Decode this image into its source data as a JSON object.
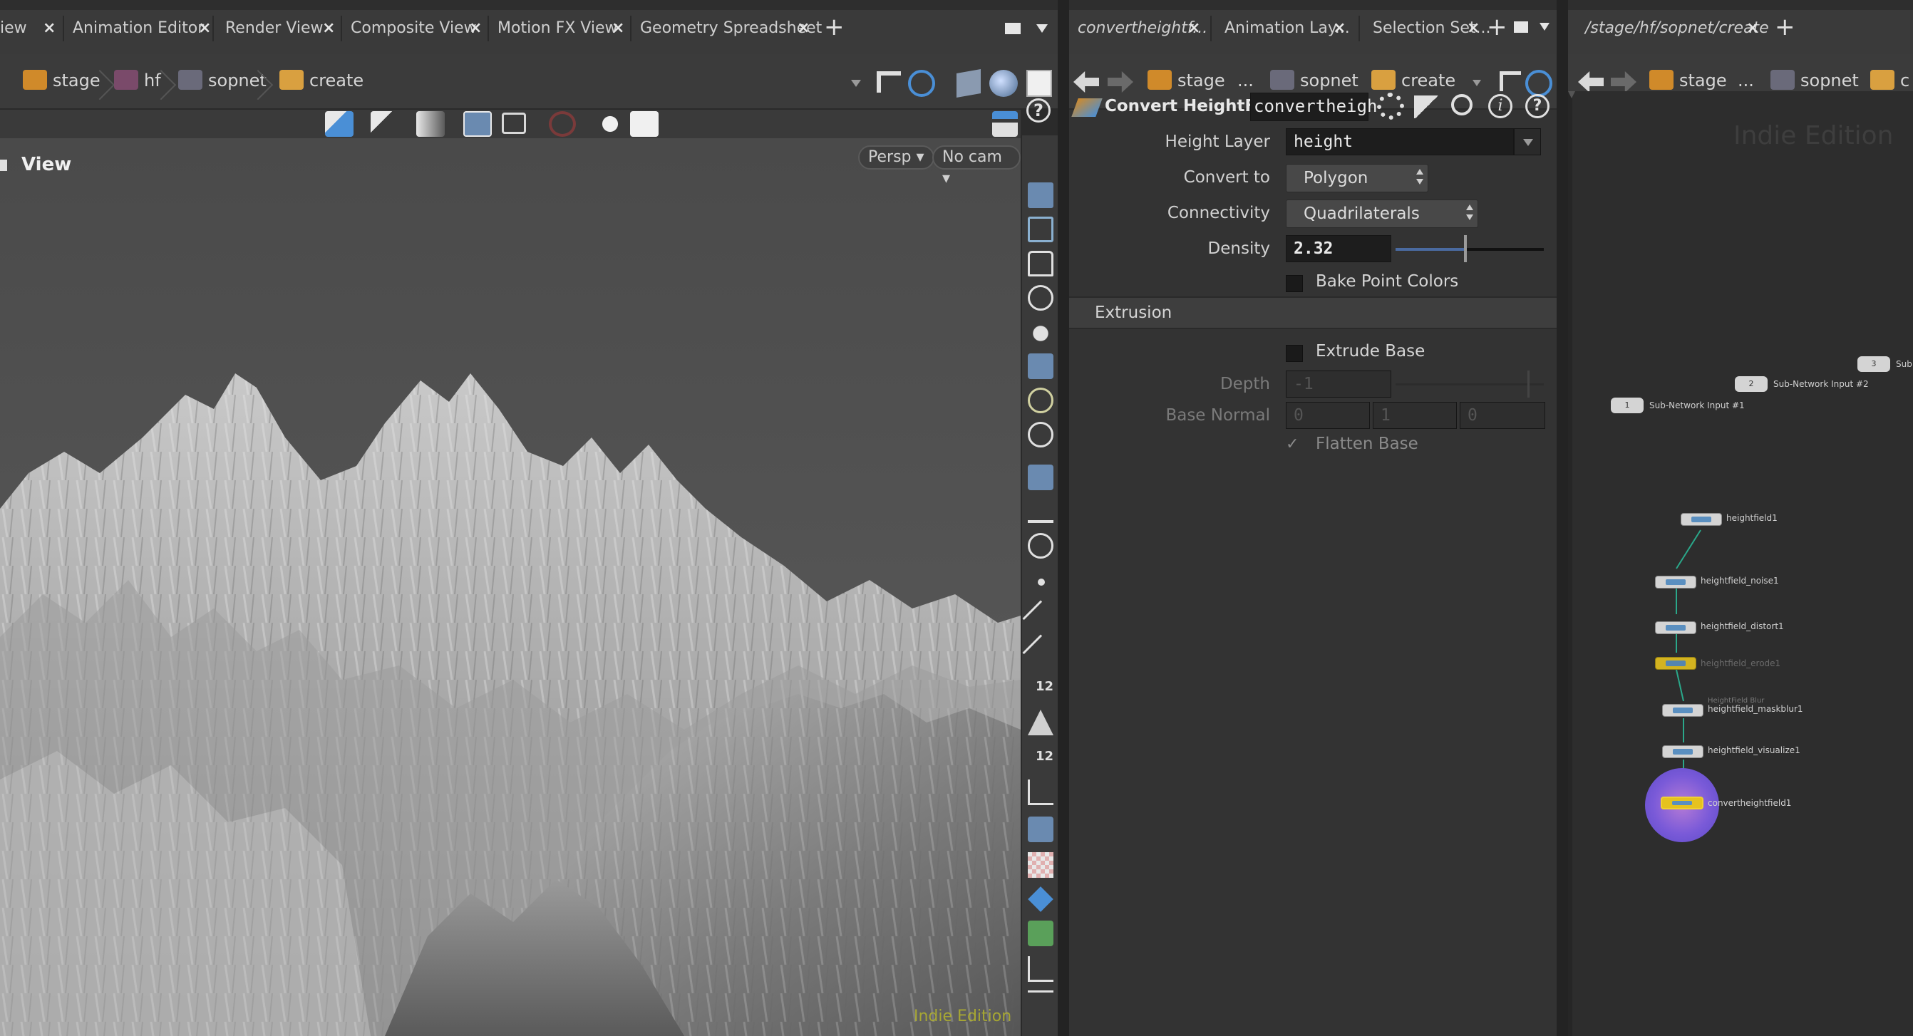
{
  "left_pane": {
    "tabs": [
      {
        "label": "iew"
      },
      {
        "label": "Animation Editor"
      },
      {
        "label": "Render View"
      },
      {
        "label": "Composite View"
      },
      {
        "label": "Motion FX View"
      },
      {
        "label": "Geometry Spreadsheet"
      }
    ],
    "path": [
      {
        "label": "stage",
        "icon": "stage-icon"
      },
      {
        "label": "hf",
        "icon": "hf-icon"
      },
      {
        "label": "sopnet",
        "icon": "sopnet-icon"
      },
      {
        "label": "create",
        "icon": "folder-icon"
      }
    ],
    "viewport": {
      "title": "View",
      "persp_label": "Persp",
      "camera_label": "No cam",
      "watermark": "Indie Edition"
    }
  },
  "params_pane": {
    "tabs": [
      {
        "label": "convertheightf..."
      },
      {
        "label": "Animation Lay..."
      },
      {
        "label": "Selection Set..."
      }
    ],
    "path": [
      {
        "label": "stage"
      },
      {
        "label": "..."
      },
      {
        "label": "sopnet"
      },
      {
        "label": "create"
      }
    ],
    "node_type": "Convert HeightF...",
    "node_name": "convertheigh",
    "height_layer": {
      "label": "Height Layer",
      "value": "height"
    },
    "convert_to": {
      "label": "Convert to",
      "value": "Polygon"
    },
    "connectivity": {
      "label": "Connectivity",
      "value": "Quadrilaterals"
    },
    "density": {
      "label": "Density",
      "value": "2.32",
      "slider_fraction": 0.46
    },
    "bake_point_colors": {
      "label": "Bake Point Colors",
      "checked": false
    },
    "extrusion_folder": "Extrusion",
    "extrude_base": {
      "label": "Extrude Base",
      "checked": false
    },
    "depth": {
      "label": "Depth",
      "value": "-1"
    },
    "base_normal": {
      "label": "Base Normal",
      "values": [
        "0",
        "1",
        "0"
      ]
    },
    "flatten_base": {
      "label": "Flatten Base",
      "checked": true
    }
  },
  "network_pane": {
    "tab_label": "/stage/hf/sopnet/create",
    "path": [
      {
        "label": "stage"
      },
      {
        "label": "..."
      },
      {
        "label": "sopnet"
      },
      {
        "label": "c"
      }
    ],
    "watermark": "Indie Edition",
    "subnet_inputs": [
      {
        "num": "1",
        "label": "Sub-Network Input #1"
      },
      {
        "num": "2",
        "label": "Sub-Network Input #2"
      },
      {
        "num": "3",
        "label": "Sub"
      }
    ],
    "nodes": [
      {
        "label": "heightfield1"
      },
      {
        "label": "heightfield_noise1"
      },
      {
        "label": "heightfield_distort1"
      },
      {
        "label": "heightfield_erode1"
      },
      {
        "label": "heightfield_maskblur1",
        "sublabel": "HeightField Blur"
      },
      {
        "label": "heightfield_visualize1"
      },
      {
        "label": "convertheightfield1"
      }
    ]
  },
  "colors": {
    "accent_blue": "#4a8fd6",
    "selected_node_ring": "#6a5bd0",
    "watermark_yellow": "#b9b92a",
    "bypass_yellow": "#e6c21f"
  }
}
